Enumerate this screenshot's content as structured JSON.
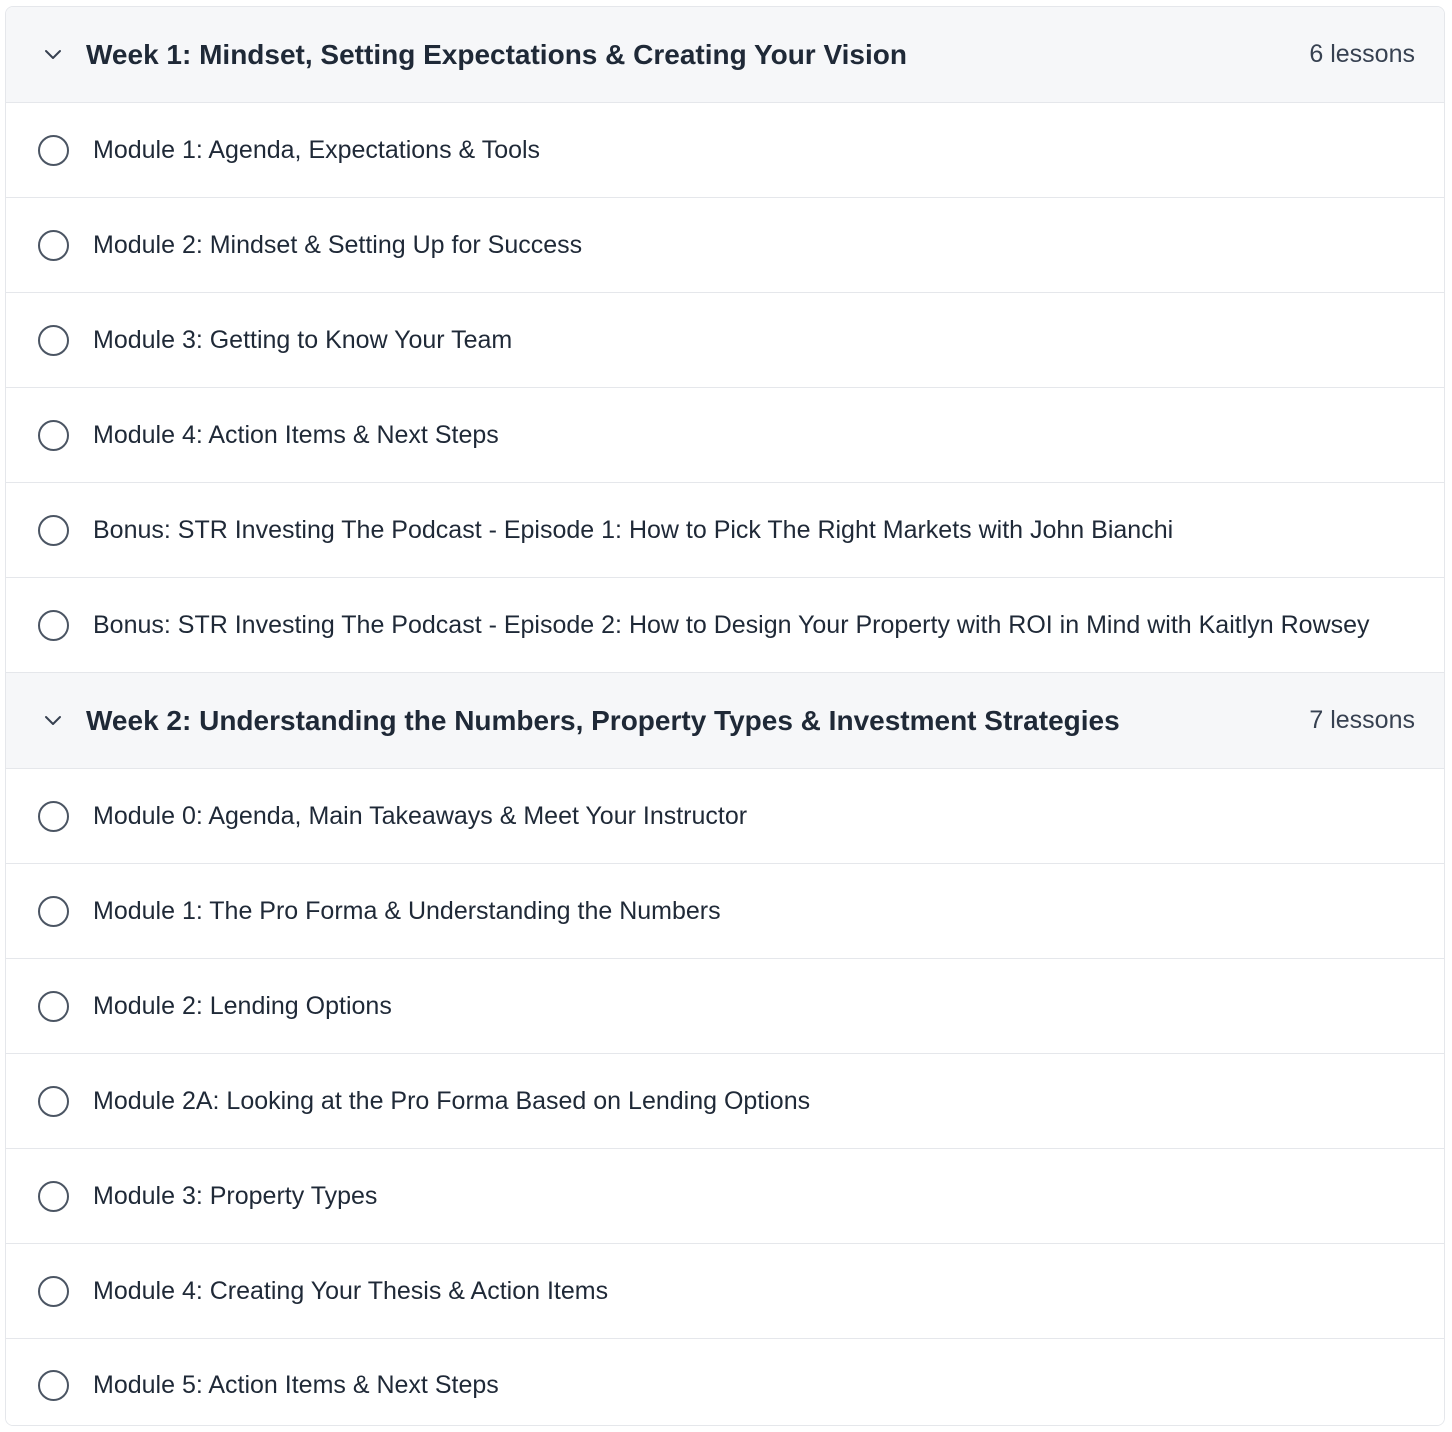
{
  "sections": [
    {
      "title": "Week 1: Mindset, Setting Expectations & Creating Your Vision",
      "count": "6 lessons",
      "icon": "chevron-down-icon",
      "lessons": [
        "Module 1: Agenda, Expectations & Tools",
        "Module 2: Mindset & Setting Up for Success",
        "Module 3: Getting to Know Your Team",
        "Module 4: Action Items & Next Steps",
        "Bonus: STR Investing The Podcast - Episode 1: How to Pick The Right Markets with John Bianchi",
        "Bonus: STR Investing The Podcast - Episode 2: How to Design Your Property with ROI in Mind with Kaitlyn Rowsey"
      ]
    },
    {
      "title": "Week 2: Understanding the Numbers, Property Types & Investment Strategies",
      "count": "7 lessons",
      "icon": "chevron-down-icon",
      "lessons": [
        "Module 0: Agenda, Main Takeaways & Meet Your Instructor",
        "Module 1: The Pro Forma & Understanding the Numbers",
        "Module 2: Lending Options",
        "Module 2A: Looking at the Pro Forma Based on Lending Options",
        "Module 3: Property Types",
        "Module 4: Creating Your Thesis & Action Items",
        "Module 5: Action Items & Next Steps"
      ]
    }
  ],
  "lesson_status_icon": "circle-outline-icon",
  "colors": {
    "header_bg": "#f6f7f9",
    "border": "#e5e7eb",
    "text": "#1f2937"
  }
}
